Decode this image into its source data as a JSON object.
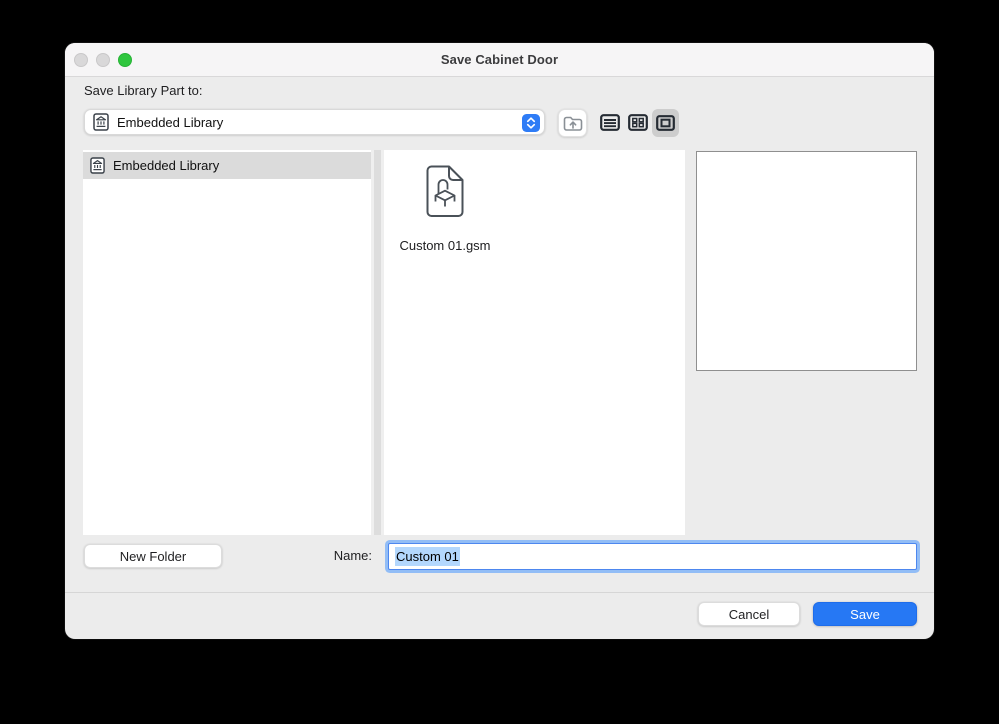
{
  "window": {
    "title": "Save Cabinet Door",
    "traffic_lights": {
      "close": "disabled-gray",
      "minimize": "disabled-gray",
      "zoom": "green"
    }
  },
  "header": {
    "destination_label": "Save Library Part to:",
    "destination_value": "Embedded Library",
    "destination_icon": "embedded-library-icon",
    "toolbar": {
      "up_button_icon": "folder-up-icon",
      "view_buttons": [
        "list-view",
        "grid-view",
        "preview-view"
      ],
      "active_view": "preview-view"
    }
  },
  "sidebar": {
    "items": [
      {
        "label": "Embedded Library",
        "icon": "embedded-library-icon",
        "selected": true
      }
    ]
  },
  "file_list": {
    "items": [
      {
        "name": "Custom 01.gsm",
        "icon": "gsm-object-document-icon"
      }
    ]
  },
  "footer": {
    "new_folder_label": "New Folder",
    "name_label": "Name:",
    "name_value": "Custom 01",
    "name_value_selected": true,
    "cancel_label": "Cancel",
    "save_label": "Save"
  },
  "colors": {
    "accent_blue": "#2678f4",
    "focus_ring_blue": "#92bdf6",
    "text_selection_blue": "#b3d7fd",
    "traffic_green": "#2fc63e",
    "traffic_disabled_gray": "#d9d8d9",
    "selected_row_gray": "#dbdbdb",
    "active_view_button_gray": "#cdcdcd",
    "dialog_background": "#ececec",
    "titlebar_background": "#f6f5f6"
  }
}
